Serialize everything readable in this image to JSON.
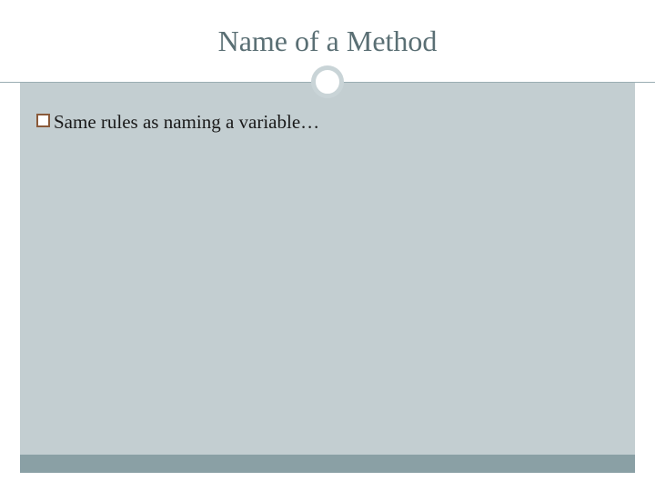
{
  "slide": {
    "title": "Name of a Method",
    "bullets": [
      {
        "text": "Same rules as naming a variable…"
      }
    ]
  },
  "theme": {
    "title_color": "#5a6f74",
    "body_bg": "#c3ced1",
    "footer_band": "#8aa0a5",
    "bullet_border": "#8a5a3a"
  }
}
